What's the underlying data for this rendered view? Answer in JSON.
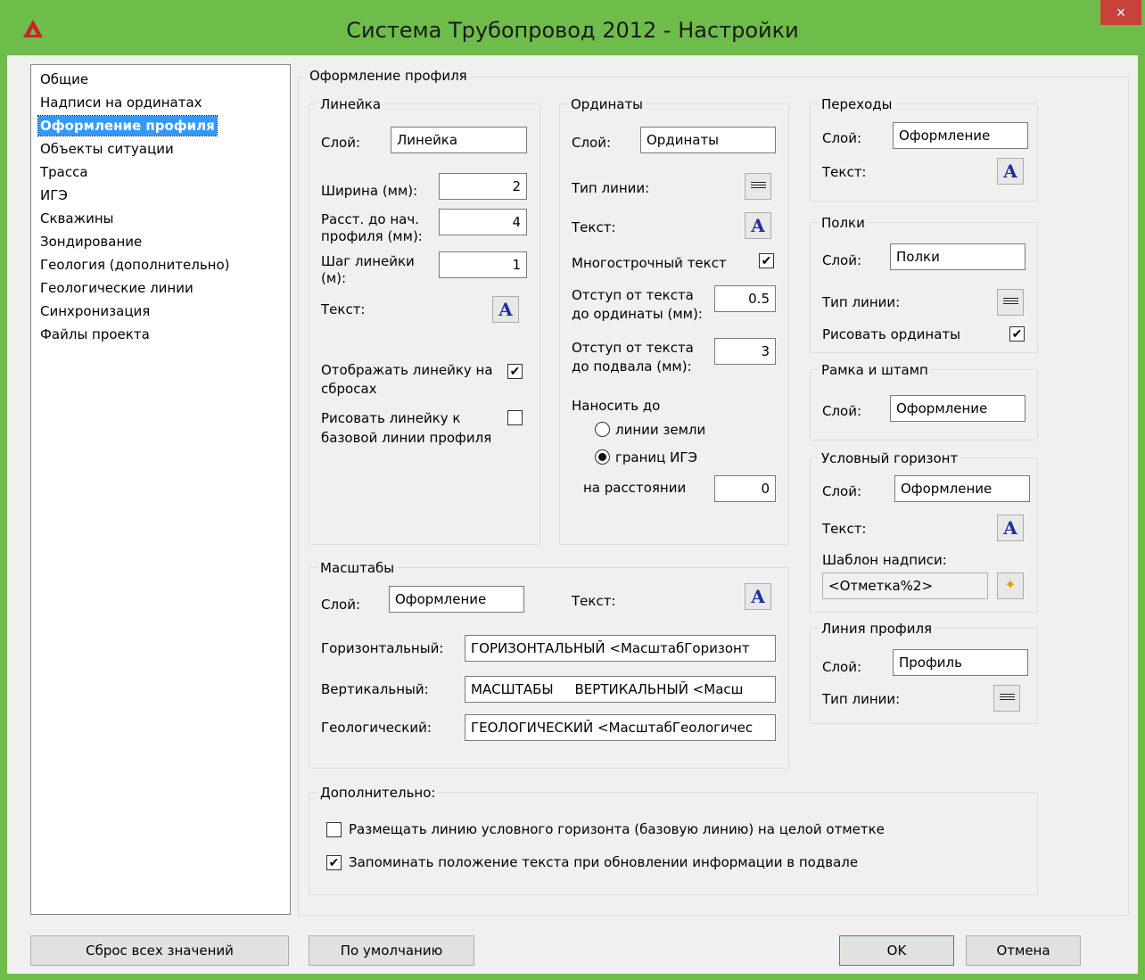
{
  "window": {
    "title": "Система Трубопровод 2012 - Настройки",
    "close_glyph": "×",
    "accent_color": "#6ebd4a"
  },
  "nav": {
    "items": [
      "Общие",
      "Надписи на ординатах",
      "Оформление профиля",
      "Объекты ситуации",
      "Трасса",
      "ИГЭ",
      "Скважины",
      "Зондирование",
      "Геология (дополнительно)",
      "Геологические линии",
      "Синхронизация",
      "Файлы проекта"
    ],
    "selected": "Оформление профиля"
  },
  "main": {
    "group_title": "Оформление профиля",
    "ruler": {
      "title": "Линейка",
      "layer_label": "Слой:",
      "layer_value": "Линейка",
      "width_label": "Ширина (мм):",
      "width_value": "2",
      "dist_label_1": "Расст. до нач.",
      "dist_label_2": "профиля (мм):",
      "dist_value": "4",
      "step_label_1": "Шаг линейки",
      "step_label_2": "(м):",
      "step_value": "1",
      "text_label": "Текст:",
      "show_on_drops_1": "Отображать линейку на",
      "show_on_drops_2": "сбросах",
      "show_on_drops_checked": true,
      "draw_to_base_1": "Рисовать линейку к",
      "draw_to_base_2": "базовой линии профиля",
      "draw_to_base_checked": false
    },
    "ordinates": {
      "title": "Ординаты",
      "layer_label": "Слой:",
      "layer_value": "Ординаты",
      "linetype_label": "Тип линии:",
      "text_label": "Текст:",
      "multiline_label": "Многострочный текст",
      "multiline_checked": true,
      "offset_text_1": "Отступ от текста",
      "offset_text_2": "до ординаты (мм):",
      "offset_text_value": "0.5",
      "offset_base_1": "Отступ от текста",
      "offset_base_2": "до подвала (мм):",
      "offset_base_value": "3",
      "draw_to_label": "Наносить до",
      "radio_ground": "линии земли",
      "radio_ige": "границ ИГЭ",
      "radio_selected": "границ ИГЭ",
      "distance_label": "на расстоянии",
      "distance_value": "0"
    },
    "scales": {
      "title": "Масштабы",
      "layer_label": "Слой:",
      "layer_value": "Оформление",
      "text_label": "Текст:",
      "horizontal_label": "Горизонтальный:",
      "horizontal_value": "ГОРИЗОНТАЛЬНЫЙ <МасштабГоризонт",
      "vertical_label": "Вертикальный:",
      "vertical_value": "МАСШТАБЫ     ВЕРТИКАЛЬНЫЙ <Масш",
      "geological_label": "Геологический:",
      "geological_value": "ГЕОЛОГИЧЕСКИЙ <МасштабГеологичес"
    },
    "transitions": {
      "title": "Переходы",
      "layer_label": "Слой:",
      "layer_value": "Оформление",
      "text_label": "Текст:"
    },
    "shelves": {
      "title": "Полки",
      "layer_label": "Слой:",
      "layer_value": "Полки",
      "linetype_label": "Тип линии:",
      "draw_ord_label": "Рисовать ординаты",
      "draw_ord_checked": true
    },
    "frame": {
      "title": "Рамка и штамп",
      "layer_label": "Слой:",
      "layer_value": "Оформление"
    },
    "horizon": {
      "title": "Условный горизонт",
      "layer_label": "Слой:",
      "layer_value": "Оформление",
      "text_label": "Текст:",
      "template_label": "Шаблон надписи:",
      "template_value": "<Отметка%2>"
    },
    "profile_line": {
      "title": "Линия профиля",
      "layer_label": "Слой:",
      "layer_value": "Профиль",
      "linetype_label": "Тип линии:"
    },
    "extra": {
      "title": "Дополнительно:",
      "opt1_label": "Размещать линию условного горизонта (базовую линию)  на целой отметке",
      "opt1_checked": false,
      "opt2_label": "Запоминать положение текста при обновлении информации в подвале",
      "opt2_checked": true
    }
  },
  "buttons": {
    "reset_all": "Сброс всех значений",
    "defaults": "По умолчанию",
    "ok": "OK",
    "cancel": "Отмена"
  },
  "icons": {
    "font_glyph": "A",
    "check_glyph": "✔",
    "wand_glyph": "✦"
  }
}
